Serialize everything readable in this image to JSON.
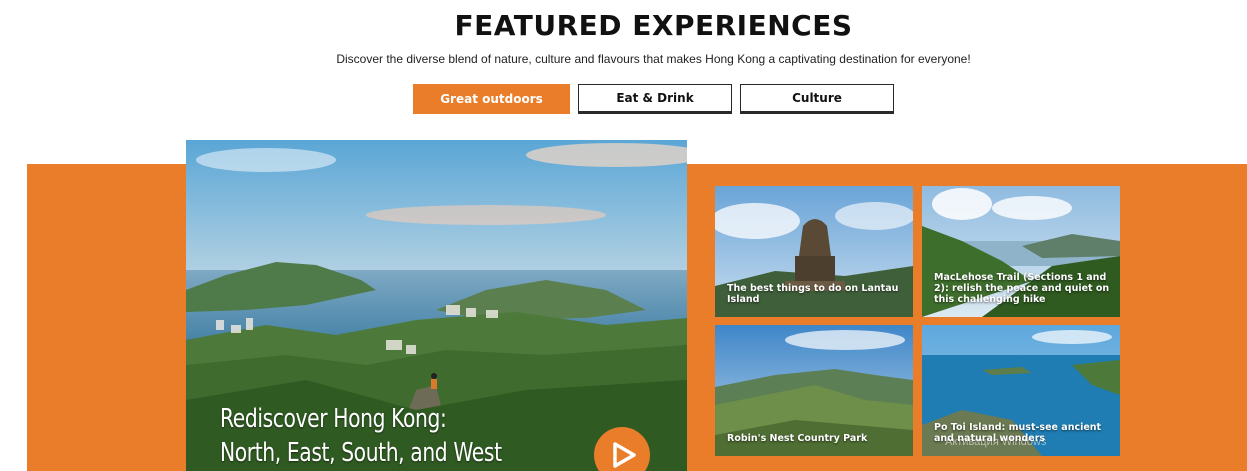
{
  "header": {
    "title": "FEATURED EXPERIENCES",
    "subtitle": "Discover the diverse blend of nature, culture and flavours that makes Hong Kong a captivating destination for everyone!"
  },
  "tabs": [
    {
      "label": "Great outdoors",
      "active": true
    },
    {
      "label": "Eat & Drink",
      "active": false
    },
    {
      "label": "Culture",
      "active": false
    }
  ],
  "hero": {
    "title_line1": "Rediscover Hong Kong:",
    "title_line2": "North, East, South, and West",
    "play_icon": "play-icon"
  },
  "cards": [
    {
      "label": "The best things to do on Lantau Island"
    },
    {
      "label": "MacLehose Trail (Sections 1 and 2): relish the peace and quiet on this challenging hike"
    },
    {
      "label": "Robin's Nest Country Park"
    },
    {
      "label": "Po Toi Island: must-see ancient and natural wonders"
    }
  ],
  "watermark": "Активация Windows",
  "colors": {
    "accent": "#ea7d2a"
  }
}
